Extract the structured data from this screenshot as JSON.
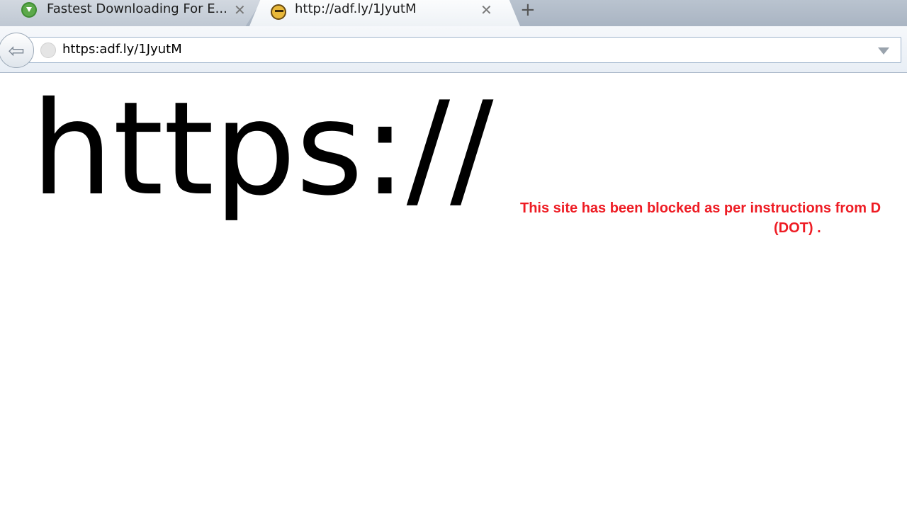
{
  "tabs": [
    {
      "title": "Fastest Downloading For E...",
      "close": "✕",
      "favicon": "download-icon",
      "active": false
    },
    {
      "title": "http://adf.ly/1JyutM",
      "close": "✕",
      "favicon": "bee-icon",
      "active": true
    }
  ],
  "new_tab_label": "+",
  "navbar": {
    "back_glyph": "⇦",
    "url_value": "https:adf.ly/1JyutM"
  },
  "page": {
    "big_text": "https://",
    "blocked_line1": "This site has been blocked as per instructions from D",
    "blocked_line2": "(DOT) ."
  },
  "colors": {
    "blocked_text": "#ee1c24",
    "tab_active": "#f4f7fa",
    "tab_inactive": "#c8d0da"
  }
}
